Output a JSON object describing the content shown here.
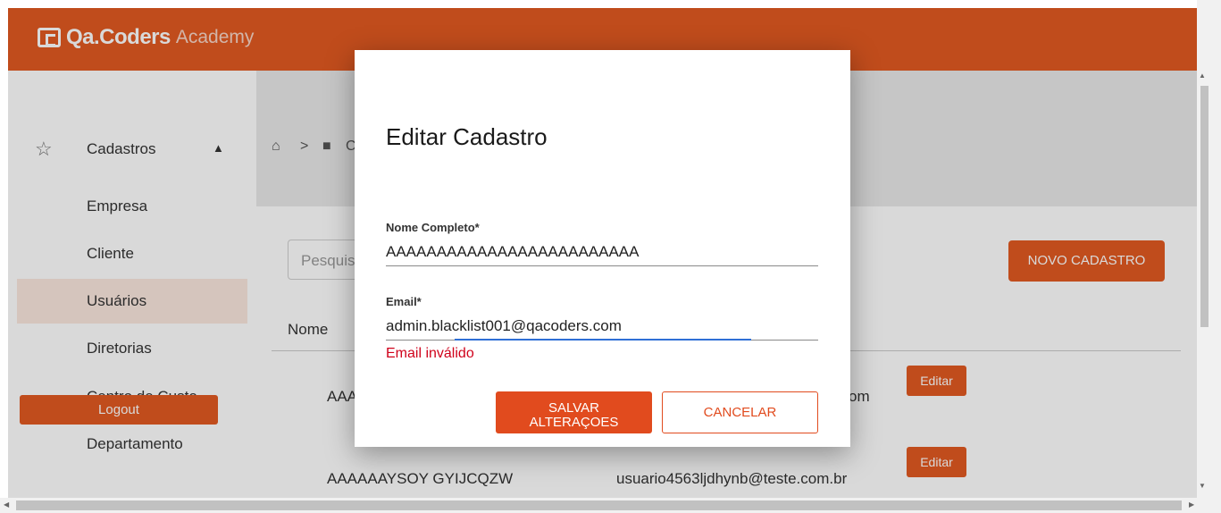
{
  "app": {
    "logo_name": "Qa.Coders",
    "logo_sub": "Academy"
  },
  "sidebar": {
    "section_label": "Cadastros",
    "items": [
      {
        "label": "Empresa",
        "active": false
      },
      {
        "label": "Cliente",
        "active": false
      },
      {
        "label": "Usuários",
        "active": true
      },
      {
        "label": "Diretorias",
        "active": false
      },
      {
        "label": "Centro de Custo",
        "active": false
      },
      {
        "label": "Departamento",
        "active": false
      }
    ],
    "logout_label": "Logout"
  },
  "breadcrumb": {
    "separator": ">",
    "partial": "C"
  },
  "toolbar": {
    "search_placeholder": "Pesquisar",
    "new_button_label": "NOVO CADASTRO"
  },
  "table": {
    "name_header": "Nome",
    "rows": [
      {
        "name": "AAA",
        "email": "om",
        "edit_label": "Editar"
      },
      {
        "name": "AAAAAAYSOY GYIJCQZW",
        "email": "usuario4563ljdhynb@teste.com.br",
        "edit_label": "Editar"
      }
    ]
  },
  "modal": {
    "title": "Editar Cadastro",
    "name_label": "Nome Completo*",
    "name_value": "AAAAAAAAAAAAAAAAAAAAAAAAA",
    "email_label": "Email*",
    "email_value": "admin.blacklist001@qacoders.com",
    "email_error": "Email inválido",
    "save_label": "SALVAR\nALTERAÇOES",
    "cancel_label": "CANCELAR"
  },
  "colors": {
    "brand": "#e25a21",
    "error": "#d0021b",
    "focus": "#2f6fd6"
  },
  "icons": {
    "section": "star-icon",
    "collapse": "chevron-up-icon",
    "home": "home-icon",
    "briefcase": "briefcase-icon"
  }
}
